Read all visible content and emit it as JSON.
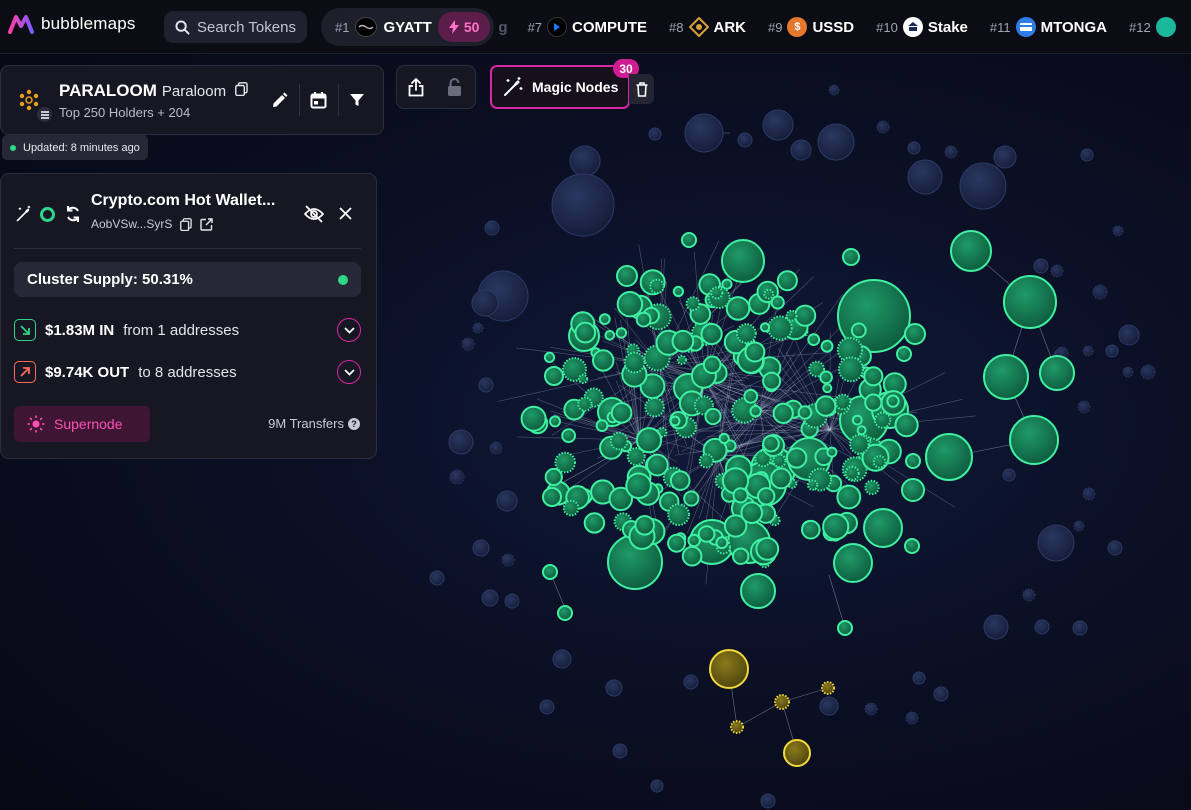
{
  "app": {
    "name": "bubblemaps"
  },
  "search": {
    "placeholder": "Search Tokens"
  },
  "ticker": [
    {
      "rank": "#1",
      "name": "GYATT",
      "boost": "50"
    },
    {
      "rank": "#7",
      "name": "COMPUTE"
    },
    {
      "rank": "#8",
      "name": "ARK"
    },
    {
      "rank": "#9",
      "name": "USSD"
    },
    {
      "rank": "#10",
      "name": "Stake"
    },
    {
      "rank": "#11",
      "name": "MTONGA"
    },
    {
      "rank": "#12",
      "name": ""
    }
  ],
  "ticker_partial_text": "g",
  "token": {
    "symbol": "PARALOOM",
    "name": "Paraloom",
    "subtitle": "Top 250 Holders + 204",
    "updated": "Updated: 8 minutes ago"
  },
  "toolbar": {
    "magic_nodes_label": "Magic Nodes",
    "magic_nodes_count": "30"
  },
  "wallet": {
    "title": "Crypto.com Hot Wallet...",
    "address": "AobVSw...SyrS",
    "cluster_supply": "Cluster Supply: 50.31%",
    "inflow_amount": "$1.83M IN",
    "inflow_desc": "from 1 addresses",
    "outflow_amount": "$9.74K OUT",
    "outflow_desc": "to 8 addresses",
    "supernode_label": "Supernode",
    "transfers": "9M Transfers"
  },
  "colors": {
    "accent_pink": "#d628a3",
    "node_green": "#2fd58a",
    "node_yellow": "#e5c92e",
    "node_dark": "#1c2748"
  },
  "icons": [
    "bubblemaps-logo",
    "search-icon",
    "lightning-icon",
    "copy-icon",
    "pencil-icon",
    "calendar-icon",
    "filter-icon",
    "share-icon",
    "lock-icon",
    "magic-wand-icon",
    "trash-icon",
    "eye-off-icon",
    "close-icon",
    "refresh-icon",
    "chevron-down-icon",
    "sun-icon",
    "help-icon"
  ]
}
